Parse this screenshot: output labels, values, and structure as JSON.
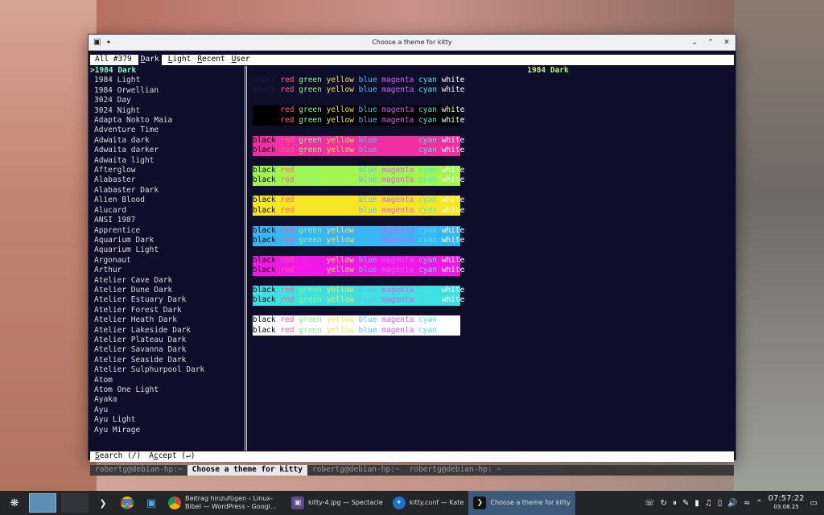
{
  "window": {
    "title": "Choose a theme for kitty"
  },
  "picker": {
    "tab_all": "All #379",
    "tab_dark_u": "D",
    "tab_dark_rest": "ark",
    "tab_light_u": "L",
    "tab_light_rest": "ight",
    "tab_recent_u": "R",
    "tab_recent_rest": "ecent",
    "tab_user_u": "U",
    "tab_user_rest": "ser",
    "themes": [
      ">1984 Dark",
      "1984 Light",
      "1984 Orwellian",
      "3024 Day",
      "3024 Night",
      "Adapta Nokto Maia",
      "Adventure Time",
      "Adwaita dark",
      "Adwaita darker",
      "Adwaita light",
      "Afterglow",
      "Alabaster",
      "Alabaster Dark",
      "Alien Blood",
      "Alucard",
      "ANSI 1987",
      "Apprentice",
      "Aquarium Dark",
      "Aquarium Light",
      "Argonaut",
      "Arthur",
      "Atelier Cave Dark",
      "Atelier Dune Dark",
      "Atelier Estuary Dark",
      "Atelier Forest Dark",
      "Atelier Heath Dark",
      "Atelier Lakeside Dark",
      "Atelier Plateau Dark",
      "Atelier Savanna Dark",
      "Atelier Seaside Dark",
      "Atelier Sulphurpool Dark",
      "Atom",
      "Atom One Light",
      "Ayaka",
      "Ayu",
      "Ayu Light",
      "Ayu Mirage"
    ],
    "preview_title": "1984 Dark",
    "search_u": "S",
    "search_rest": "earch (/)",
    "accept_pre": "A",
    "accept_u": "c",
    "accept_rest": "cept (↵)"
  },
  "kitty_tabs": [
    "robertg@debian-hp:~",
    "Choose a theme for kitty",
    "robertg@debian-hp:~",
    "robertg@debian-hp: ~"
  ],
  "palette_words": [
    "black",
    "red",
    "green",
    "yellow",
    "blue",
    "magenta",
    "cyan",
    "white"
  ],
  "colors": {
    "term_bg": "#0e0e2a",
    "selected_theme": "#7dffbe",
    "preview_title": "#b9f27b",
    "red": "#ff5f87",
    "green": "#8cf58c",
    "yellow": "#f5e14d",
    "blue": "#5fb8f5",
    "magenta": "#d75ff5",
    "cyan": "#4fe3e3",
    "white": "#ffffff"
  },
  "taskbar": {
    "tasks": [
      "Beitrag hinzufügen ‹ Linux-Bibel — WordPress - Googl...",
      "kitty-4.jpg — Spectacle",
      "kitty.conf — Kate",
      "Choose a theme for kitty"
    ],
    "time": "07:57:22",
    "date": "03.08.25"
  }
}
